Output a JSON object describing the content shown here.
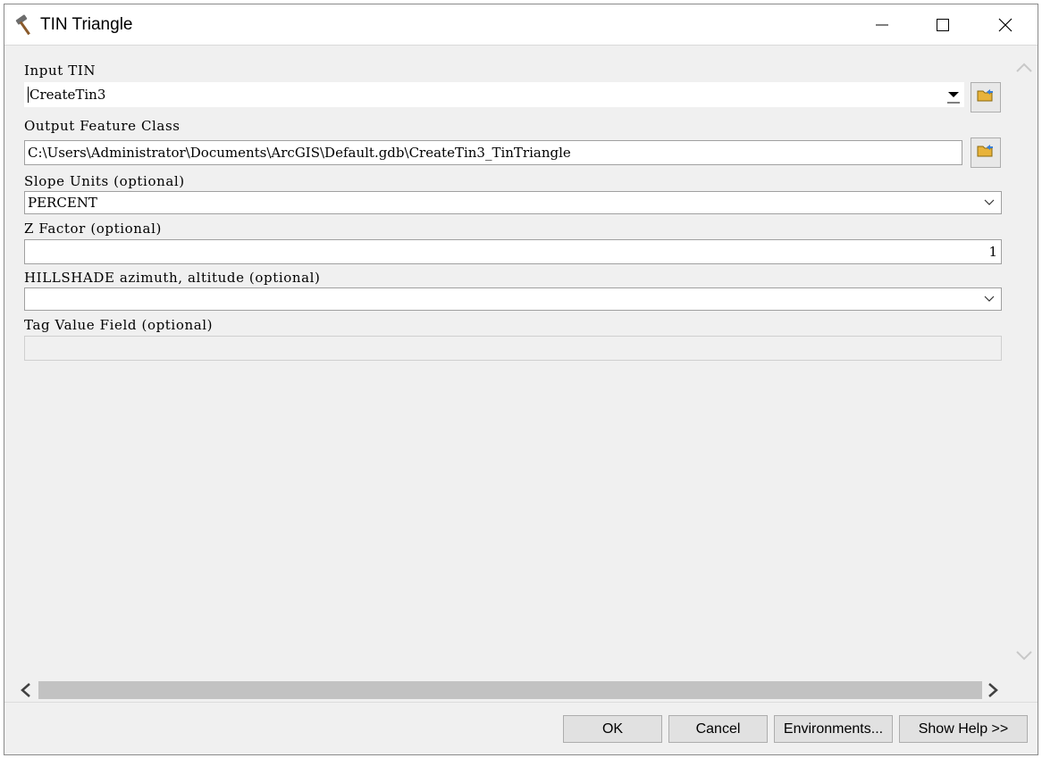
{
  "window": {
    "title": "TIN Triangle",
    "app_icon": "hammer-icon"
  },
  "form": {
    "input_tin": {
      "label": "Input TIN",
      "value": "CreateTin3"
    },
    "output_feature_class": {
      "label": "Output Feature Class",
      "value": "C:\\Users\\Administrator\\Documents\\ArcGIS\\Default.gdb\\CreateTin3_TinTriangle"
    },
    "slope_units": {
      "label": "Slope Units (optional)",
      "value": "PERCENT"
    },
    "z_factor": {
      "label": "Z Factor (optional)",
      "value": "1"
    },
    "hillshade": {
      "label": "HILLSHADE azimuth, altitude (optional)",
      "value": ""
    },
    "tag_value_field": {
      "label": "Tag Value Field (optional)",
      "value": ""
    }
  },
  "buttons": {
    "ok": "OK",
    "cancel": "Cancel",
    "environments": "Environments...",
    "show_help": "Show Help >>"
  },
  "colors": {
    "background": "#f0f0f0",
    "field_background": "#ffffff",
    "folder_icon": "#e8b33a"
  }
}
